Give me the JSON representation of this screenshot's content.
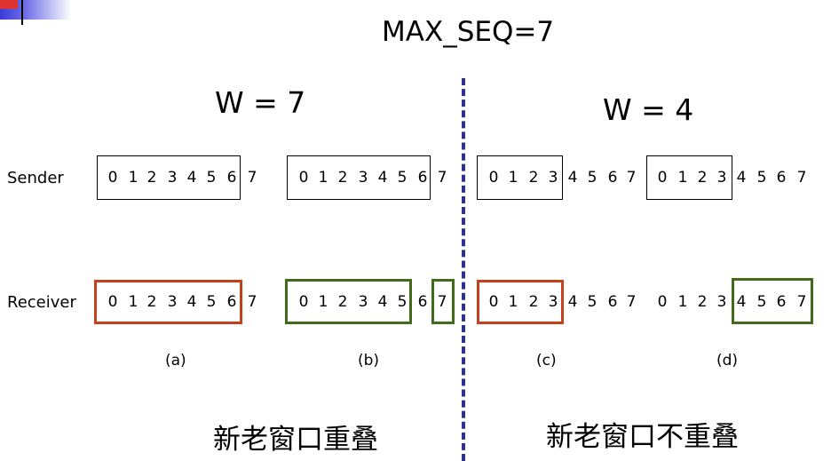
{
  "title": "MAX_SEQ=7",
  "left": {
    "window_label": "W = 7",
    "summary": "新老窗口重叠"
  },
  "right": {
    "window_label": "W = 4",
    "summary": "新老窗口不重叠"
  },
  "rows": {
    "sender": "Sender",
    "receiver": "Receiver"
  },
  "captions": [
    "(a)",
    "(b)",
    "(c)",
    "(d)"
  ],
  "sequence": [
    "0",
    "1",
    "2",
    "3",
    "4",
    "5",
    "6",
    "7"
  ],
  "colors": {
    "highlight_red": "#c8401a",
    "highlight_green": "#3f6b1a",
    "divider": "#2f318f"
  }
}
